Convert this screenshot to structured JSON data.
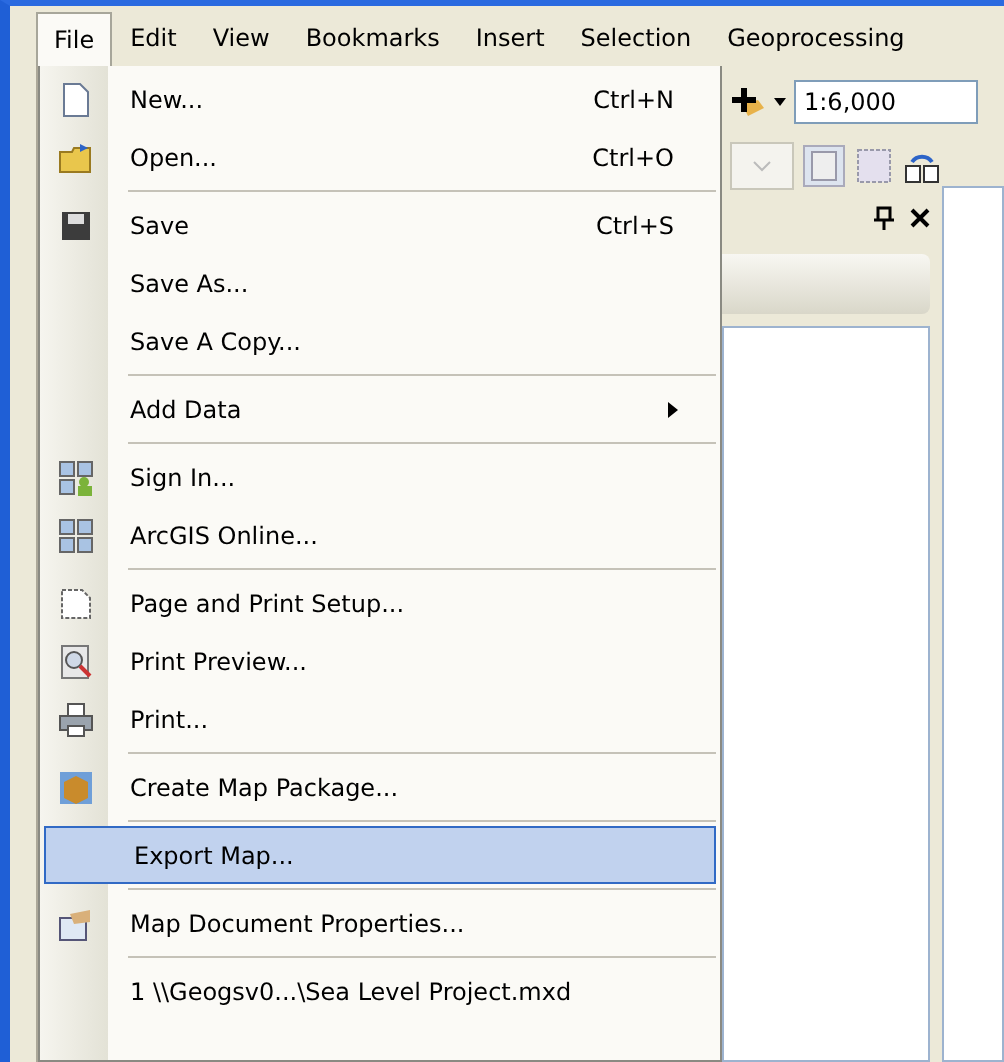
{
  "menubar": [
    {
      "label": "File",
      "selected": true
    },
    {
      "label": "Edit",
      "selected": false
    },
    {
      "label": "View",
      "selected": false
    },
    {
      "label": "Bookmarks",
      "selected": false
    },
    {
      "label": "Insert",
      "selected": false
    },
    {
      "label": "Selection",
      "selected": false
    },
    {
      "label": "Geoprocessing",
      "selected": false
    }
  ],
  "file_menu": [
    {
      "kind": "item",
      "label": "New...",
      "shortcut": "Ctrl+N",
      "selected": false
    },
    {
      "kind": "item",
      "label": "Open...",
      "shortcut": "Ctrl+O",
      "selected": false
    },
    {
      "kind": "separator"
    },
    {
      "kind": "item",
      "label": "Save",
      "shortcut": "Ctrl+S",
      "selected": false
    },
    {
      "kind": "item",
      "label": "Save As...",
      "selected": false
    },
    {
      "kind": "item",
      "label": "Save A Copy...",
      "selected": false
    },
    {
      "kind": "separator"
    },
    {
      "kind": "submenu",
      "label": "Add Data",
      "selected": false
    },
    {
      "kind": "separator"
    },
    {
      "kind": "item",
      "label": "Sign In...",
      "selected": false
    },
    {
      "kind": "item",
      "label": "ArcGIS Online...",
      "selected": false
    },
    {
      "kind": "separator"
    },
    {
      "kind": "item",
      "label": "Page and Print Setup...",
      "selected": false
    },
    {
      "kind": "item",
      "label": "Print Preview...",
      "selected": false
    },
    {
      "kind": "item",
      "label": "Print...",
      "selected": false
    },
    {
      "kind": "separator"
    },
    {
      "kind": "item",
      "label": "Create Map Package...",
      "selected": false
    },
    {
      "kind": "separator"
    },
    {
      "kind": "item",
      "label": "Export Map...",
      "selected": true
    },
    {
      "kind": "separator"
    },
    {
      "kind": "item",
      "label": "Map Document Properties...",
      "selected": false
    },
    {
      "kind": "separator"
    },
    {
      "kind": "item",
      "label": "1 \\\\Geogsv0...\\Sea Level Project.mxd",
      "selected": false
    }
  ],
  "toolbar": {
    "scale": "1:6,000"
  }
}
